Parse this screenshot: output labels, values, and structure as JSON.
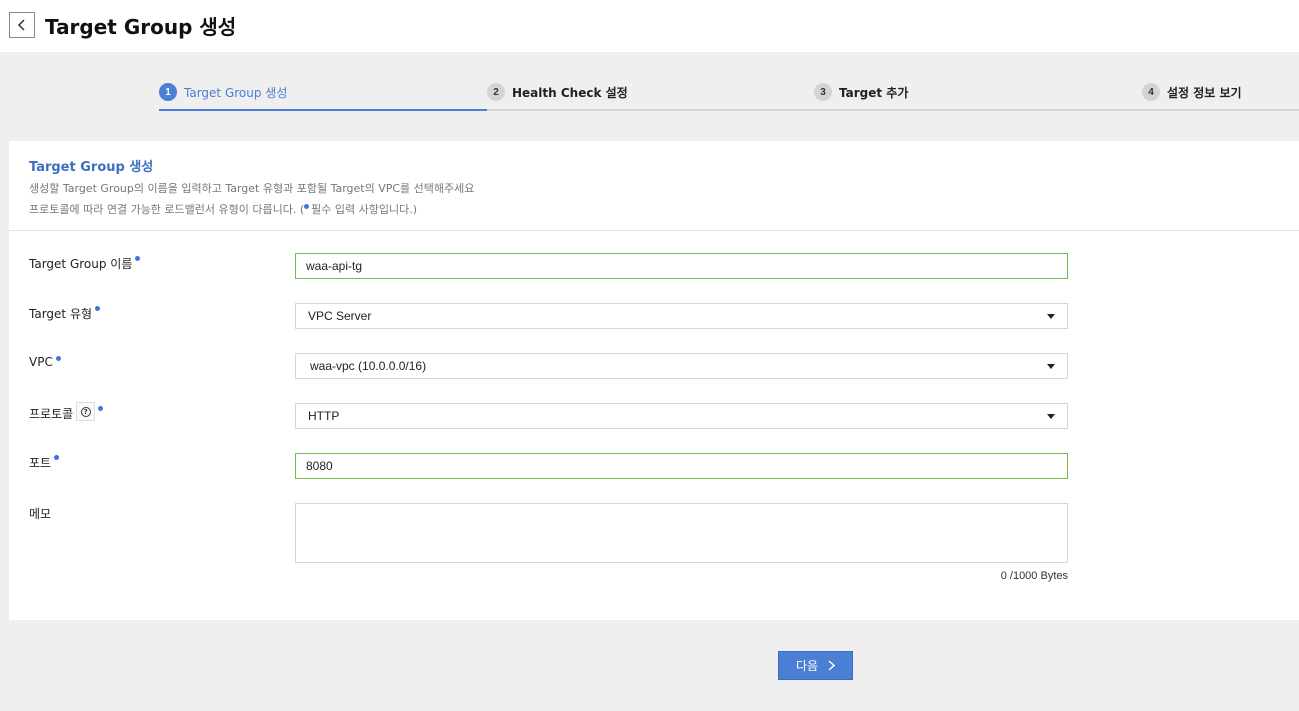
{
  "header": {
    "title": "Target Group 생성"
  },
  "steps": [
    {
      "num": "1",
      "label": "Target Group 생성"
    },
    {
      "num": "2",
      "label": "Health Check 설정"
    },
    {
      "num": "3",
      "label": "Target 추가"
    },
    {
      "num": "4",
      "label": "설정 정보 보기"
    }
  ],
  "card": {
    "title": "Target Group 생성",
    "desc_line1": "생성할 Target Group의 이름을 입력하고 Target 유형과 포함될 Target의 VPC를 선택해주세요",
    "desc_line2_pre": "프로토콜에 따라 연결 가능한 로드밸런서 유형이 다릅니다. (",
    "desc_line2_post": "필수 입력 사항입니다.)"
  },
  "form": {
    "name_label": "Target Group 이름",
    "name_value": "waa-api-tg",
    "type_label": "Target 유형",
    "type_value": "VPC Server",
    "vpc_label": "VPC",
    "vpc_value": "waa-vpc (10.0.0.0/16)",
    "protocol_label": "프로토콜",
    "protocol_help": "?",
    "protocol_value": "HTTP",
    "port_label": "포트",
    "port_value": "8080",
    "memo_label": "메모",
    "memo_count": "0 /1000 Bytes"
  },
  "footer": {
    "next_label": "다음"
  },
  "colors": {
    "accent": "#4a7fd4",
    "valid_border": "#6cbf4a",
    "required_dot": "#3d75d9"
  }
}
